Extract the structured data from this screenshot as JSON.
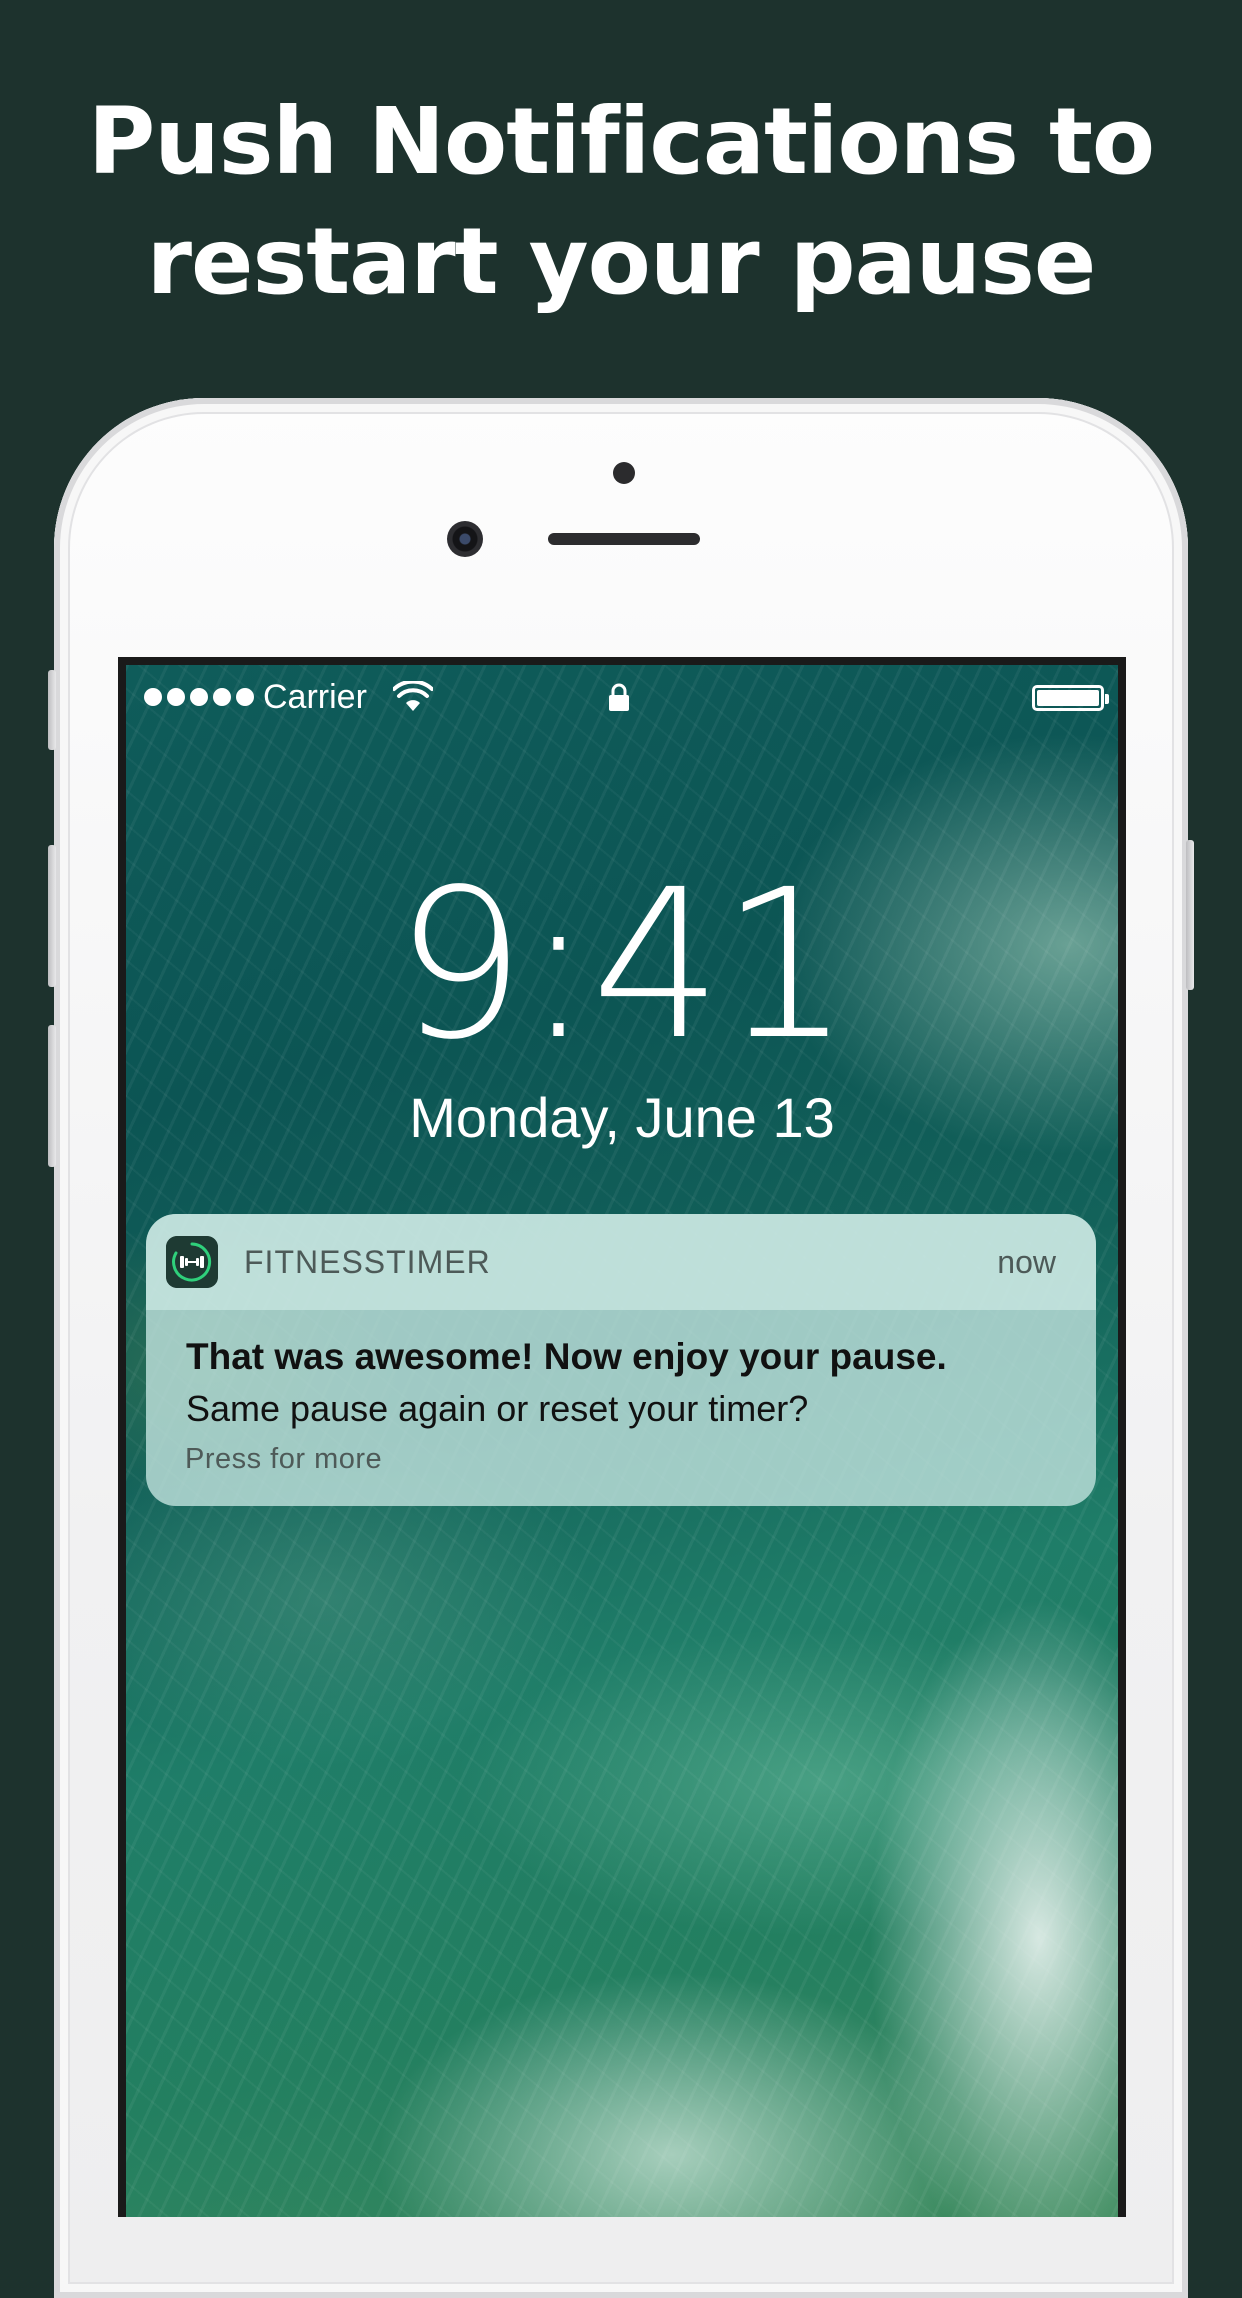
{
  "headline": {
    "line1": "Push Notifications to",
    "line2": "restart your pause"
  },
  "status_bar": {
    "carrier": "Carrier",
    "signal_icon": "signal-dots-icon",
    "wifi_icon": "wifi-icon",
    "lock_icon": "lock-icon",
    "battery_icon": "battery-icon",
    "battery_level": 1.0
  },
  "lock_screen": {
    "time": "9:41",
    "date": "Monday, June 13"
  },
  "notification": {
    "app_icon": "dumbbell-icon",
    "app_name": "FITNESSTIMER",
    "time": "now",
    "title": "That was awesome! Now enjoy your pause.",
    "body": "Same pause again or reset your timer?",
    "hint": "Press for more"
  },
  "colors": {
    "background": "#1d322d",
    "app_accent": "#2fd07b"
  }
}
